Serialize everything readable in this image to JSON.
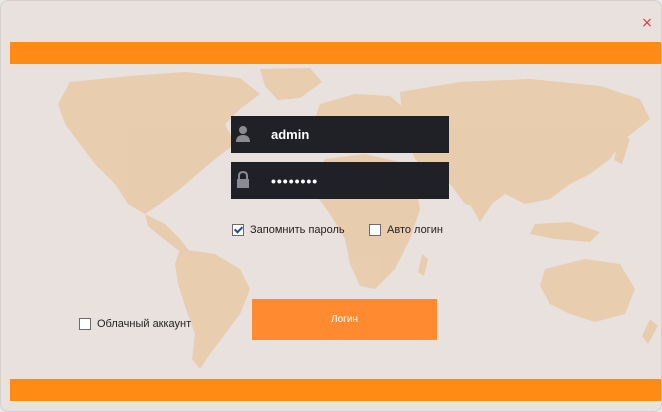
{
  "window": {
    "close_symbol": "×"
  },
  "login": {
    "username": "admin",
    "password": "••••••••",
    "button_label": "Логин"
  },
  "options": {
    "remember_password": {
      "label": "Запомнить пароль",
      "checked": true
    },
    "auto_login": {
      "label": "Авто логин",
      "checked": false
    },
    "cloud_account": {
      "label": "Облачный аккаунт",
      "checked": false
    }
  },
  "colors": {
    "accent": "#ff8a14",
    "button": "#ff8a30",
    "field_bg": "#1f2127",
    "close": "#e03a2f",
    "map": "#e8c9a6"
  },
  "icons": {
    "user": "user-icon",
    "password": "lock-icon",
    "close": "close-icon"
  }
}
